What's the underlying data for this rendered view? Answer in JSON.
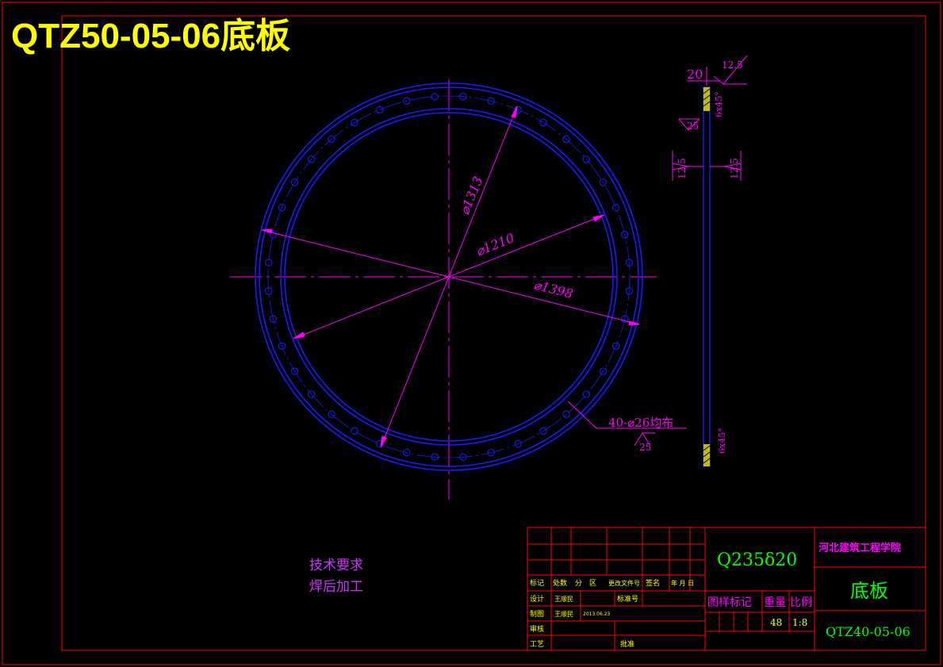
{
  "header": {
    "title": "QTZ50-05-06底板"
  },
  "colors": {
    "frame": "#ff0000",
    "ring": "#1a1aff",
    "dimension": "#ff00ff",
    "centerline": "#ff00ff",
    "title_text": "#ffff00",
    "green_text": "#00ff00",
    "yellow_section": "#ffff00",
    "background": "#000000"
  },
  "dimensions": {
    "d_bolt_circle": "⌀1313",
    "d_inner": "⌀1210",
    "d_outer": "⌀1398",
    "holes": "40-⌀26均布",
    "holes_rough": "25",
    "thickness": "20",
    "rough_top": "12.5",
    "rough_left": "25",
    "rough_mid_left": "12.5",
    "rough_mid_right": "12.5",
    "chamfer_top": "6x45°",
    "chamfer_bottom": "6x45°"
  },
  "notes": {
    "title": "技术要求",
    "line1": "焊后加工"
  },
  "title_block": {
    "material": "Q235δ20",
    "school": "河北建筑工程学院",
    "part_name": "底板",
    "drawing_no": "QTZ40-05-06",
    "weight": "48",
    "scale": "1:8",
    "col_mark": "标记",
    "col_count": "处数",
    "col_zone": "分　区",
    "col_change_doc": "更改文件号",
    "col_sign": "签名",
    "col_date": "年 月 日",
    "row_design": "设计",
    "designer": "王顺民",
    "std_label": "标准号",
    "row_draw": "制图",
    "drawer": "王顺民",
    "draw_date": "2013.06.23",
    "row_check": "审核",
    "row_process": "工艺",
    "approve": "批准",
    "stage_label": "图样标记",
    "weight_label": "重量",
    "scale_label": "比例"
  }
}
